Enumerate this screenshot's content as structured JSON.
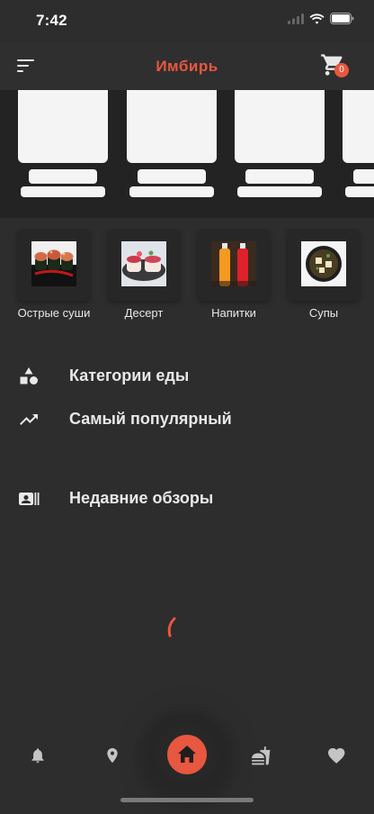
{
  "status_bar": {
    "time": "7:42"
  },
  "header": {
    "title": "Имбирь",
    "cart_count": "0"
  },
  "categories": [
    {
      "label": "Острые суши"
    },
    {
      "label": "Десерт"
    },
    {
      "label": "Напитки"
    },
    {
      "label": "Супы"
    }
  ],
  "menu": {
    "food_categories": "Категории еды",
    "most_popular": "Самый популярный",
    "recent_reviews": "Недавние обзоры"
  },
  "colors": {
    "accent": "#e8573f",
    "background": "#2d2d2d",
    "skeleton": "#f4f4f4"
  },
  "icons": {
    "menu": "sort-menu-icon",
    "cart": "shopping-cart-icon",
    "categories": "shapes-icon",
    "popular": "trending-up-icon",
    "reviews": "contact-card-icon",
    "nav": [
      "bell-icon",
      "location-pin-icon",
      "home-icon",
      "fastfood-icon",
      "heart-icon"
    ]
  }
}
